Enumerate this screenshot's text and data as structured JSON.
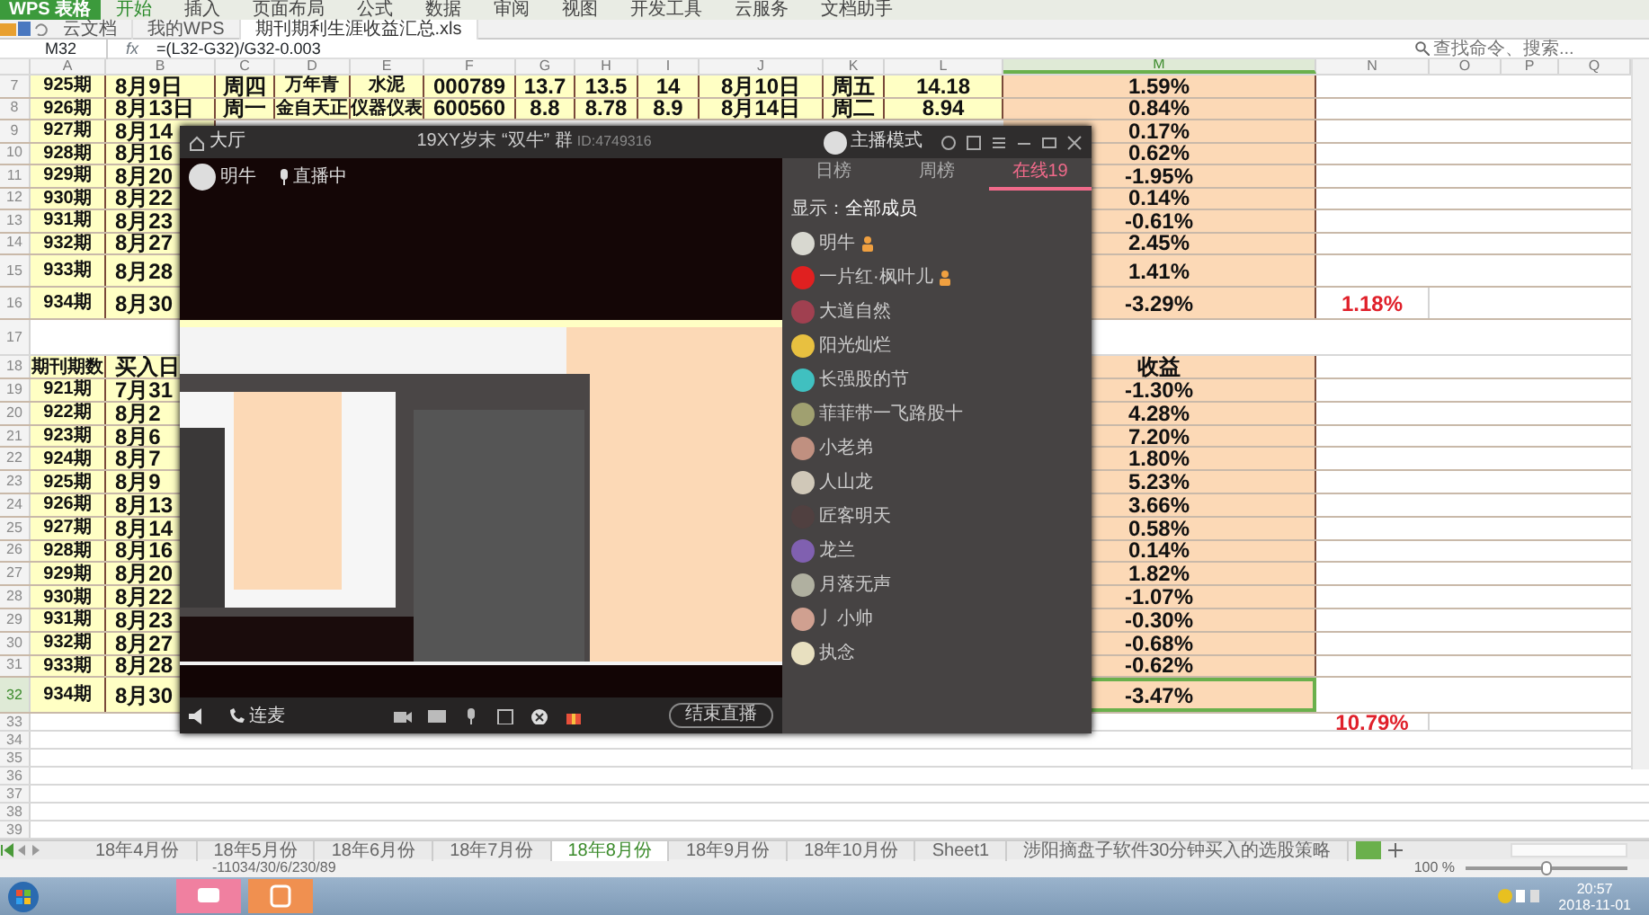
{
  "app": {
    "title": "WPS 表格",
    "menu": [
      {
        "label": "开始",
        "selected": true
      },
      {
        "label": "插入",
        "selected": false
      },
      {
        "label": "页面布局",
        "selected": false
      },
      {
        "label": "公式",
        "selected": false
      },
      {
        "label": "数据",
        "selected": false
      },
      {
        "label": "审阅",
        "selected": false
      },
      {
        "label": "视图",
        "selected": false
      },
      {
        "label": "开发工具",
        "selected": false
      },
      {
        "label": "云服务",
        "selected": false
      },
      {
        "label": "文档助手",
        "selected": false
      }
    ],
    "doc_tabs": [
      {
        "label": "云文档",
        "selected": false
      },
      {
        "label": "我的WPS",
        "selected": false
      },
      {
        "label": "期刊期利生涯收益汇总.xls",
        "selected": true
      }
    ],
    "search": {
      "placeholder": "查找命令、搜索..."
    }
  },
  "formula_bar": {
    "cell": "M32",
    "fx": "fx",
    "formula": "=(L32-G32)/G32-0.003"
  },
  "sheet": {
    "columns": [
      {
        "letter": "A",
        "selected": false
      },
      {
        "letter": "B",
        "selected": false
      },
      {
        "letter": "C",
        "selected": false
      },
      {
        "letter": "D",
        "selected": false
      },
      {
        "letter": "E",
        "selected": false
      },
      {
        "letter": "F",
        "selected": false
      },
      {
        "letter": "G",
        "selected": false
      },
      {
        "letter": "H",
        "selected": false
      },
      {
        "letter": "I",
        "selected": false
      },
      {
        "letter": "J",
        "selected": false
      },
      {
        "letter": "K",
        "selected": false
      },
      {
        "letter": "L",
        "selected": false
      },
      {
        "letter": "M",
        "selected": true
      },
      {
        "letter": "N",
        "selected": false
      },
      {
        "letter": "O",
        "selected": false
      },
      {
        "letter": "P",
        "selected": false
      },
      {
        "letter": "Q",
        "selected": false
      }
    ],
    "rows": [
      {
        "number": "7",
        "kind": "record",
        "selected": false,
        "cells": {
          "A": "925期",
          "B": "8月9日",
          "C": "周四",
          "D": "万年青",
          "E": "水泥",
          "F": "000789",
          "G": "13.7",
          "H": "13.5",
          "I": "14",
          "J": "8月10日",
          "K": "周五",
          "L": "14.18",
          "M": "1.59%"
        }
      },
      {
        "number": "8",
        "kind": "record",
        "selected": false,
        "cells": {
          "A": "926期",
          "B": "8月13日",
          "C": "周一",
          "D": "金自天正",
          "E": "仪器仪表",
          "F": "600560",
          "G": "8.8",
          "H": "8.78",
          "I": "8.9",
          "J": "8月14日",
          "K": "周二",
          "L": "8.94",
          "M": "0.84%"
        }
      },
      {
        "number": "9",
        "kind": "record",
        "selected": false,
        "cells": {
          "A": "927期",
          "B": "8月14",
          "M": "0.17%"
        }
      },
      {
        "number": "10",
        "kind": "record",
        "selected": false,
        "cells": {
          "A": "928期",
          "B": "8月16",
          "M": "0.62%"
        }
      },
      {
        "number": "11",
        "kind": "record",
        "selected": false,
        "cells": {
          "A": "929期",
          "B": "8月20",
          "M": "-1.95%"
        }
      },
      {
        "number": "12",
        "kind": "record",
        "selected": false,
        "cells": {
          "A": "930期",
          "B": "8月22",
          "M": "0.14%"
        }
      },
      {
        "number": "13",
        "kind": "record",
        "selected": false,
        "cells": {
          "A": "931期",
          "B": "8月23",
          "M": "-0.61%"
        }
      },
      {
        "number": "14",
        "kind": "record",
        "selected": false,
        "cells": {
          "A": "932期",
          "B": "8月27",
          "M": "2.45%"
        }
      },
      {
        "number": "15",
        "kind": "record",
        "selected": false,
        "cells": {
          "A": "933期",
          "B": "8月28",
          "M": "1.41%"
        }
      },
      {
        "number": "16",
        "kind": "record",
        "selected": false,
        "cells": {
          "A": "934期",
          "B": "8月30",
          "M": "-3.29%",
          "N": "1.18%"
        }
      },
      {
        "number": "17",
        "kind": "blank",
        "selected": false,
        "cells": {}
      },
      {
        "number": "18",
        "kind": "record",
        "selected": false,
        "cells": {
          "A": "期刊期数",
          "B": "买入日",
          "M": "收益"
        }
      },
      {
        "number": "19",
        "kind": "record",
        "selected": false,
        "cells": {
          "A": "921期",
          "B": "7月31",
          "M": "-1.30%"
        }
      },
      {
        "number": "20",
        "kind": "record",
        "selected": false,
        "cells": {
          "A": "922期",
          "B": "8月2",
          "M": "4.28%"
        }
      },
      {
        "number": "21",
        "kind": "record",
        "selected": false,
        "cells": {
          "A": "923期",
          "B": "8月6",
          "M": "7.20%"
        }
      },
      {
        "number": "22",
        "kind": "record",
        "selected": false,
        "cells": {
          "A": "924期",
          "B": "8月7",
          "M": "1.80%"
        }
      },
      {
        "number": "23",
        "kind": "record",
        "selected": false,
        "cells": {
          "A": "925期",
          "B": "8月9",
          "M": "5.23%"
        }
      },
      {
        "number": "24",
        "kind": "record",
        "selected": false,
        "cells": {
          "A": "926期",
          "B": "8月13",
          "M": "3.66%"
        }
      },
      {
        "number": "25",
        "kind": "record",
        "selected": false,
        "cells": {
          "A": "927期",
          "B": "8月14",
          "M": "0.58%"
        }
      },
      {
        "number": "26",
        "kind": "record",
        "selected": false,
        "cells": {
          "A": "928期",
          "B": "8月16",
          "M": "0.14%"
        }
      },
      {
        "number": "27",
        "kind": "record",
        "selected": false,
        "cells": {
          "A": "929期",
          "B": "8月20",
          "M": "1.82%"
        }
      },
      {
        "number": "28",
        "kind": "record",
        "selected": false,
        "cells": {
          "A": "930期",
          "B": "8月22",
          "M": "-1.07%"
        }
      },
      {
        "number": "29",
        "kind": "record",
        "selected": false,
        "cells": {
          "A": "931期",
          "B": "8月23",
          "M": "-0.30%"
        }
      },
      {
        "number": "30",
        "kind": "record",
        "selected": false,
        "cells": {
          "A": "932期",
          "B": "8月27",
          "M": "-0.68%"
        }
      },
      {
        "number": "31",
        "kind": "record",
        "selected": false,
        "cells": {
          "A": "933期",
          "B": "8月28",
          "M": "-0.62%"
        }
      },
      {
        "number": "32",
        "kind": "record",
        "selected": true,
        "cells": {
          "A": "934期",
          "B": "8月30",
          "M": "-3.47%"
        }
      },
      {
        "number": "33",
        "kind": "blank",
        "selected": false,
        "cells": {
          "N": "10.79%"
        }
      },
      {
        "number": "34",
        "kind": "blank",
        "selected": false,
        "cells": {}
      },
      {
        "number": "35",
        "kind": "blank",
        "selected": false,
        "cells": {}
      },
      {
        "number": "36",
        "kind": "blank",
        "selected": false,
        "cells": {}
      },
      {
        "number": "37",
        "kind": "blank",
        "selected": false,
        "cells": {}
      },
      {
        "number": "38",
        "kind": "blank",
        "selected": false,
        "cells": {}
      },
      {
        "number": "39",
        "kind": "blank",
        "selected": false,
        "cells": {}
      }
    ]
  },
  "chat_window": {
    "home_label": "大厅",
    "title": "19XY岁末 “双牛” 群",
    "room_id": "ID:4749316",
    "mode_label": "主播模式",
    "host_name": "明牛",
    "host_status": "直播中",
    "tabs": [
      {
        "label": "日榜",
        "selected": false
      },
      {
        "label": "周榜",
        "selected": false
      },
      {
        "label": "在线19",
        "selected": true
      }
    ],
    "filter_label": "显示：",
    "filter_value": "全部成员",
    "members": [
      {
        "name": "明牛",
        "admin": true,
        "color": "#d8d8d0"
      },
      {
        "name": "一片红·枫叶儿",
        "admin": true,
        "color": "#e02020"
      },
      {
        "name": "大道自然",
        "admin": false,
        "color": "#a04050"
      },
      {
        "name": "阳光灿烂",
        "admin": false,
        "color": "#e8c040"
      },
      {
        "name": "长强股的节",
        "admin": false,
        "color": "#40c0c0"
      },
      {
        "name": "菲菲带一飞路股十",
        "admin": false,
        "color": "#a0a070"
      },
      {
        "name": "小老弟",
        "admin": false,
        "color": "#c09080"
      },
      {
        "name": "人山龙",
        "admin": false,
        "color": "#d0c8b8"
      },
      {
        "name": "匠客明天",
        "admin": false,
        "color": "#504040"
      },
      {
        "name": "龙兰",
        "admin": false,
        "color": "#8060b0"
      },
      {
        "name": "月落无声",
        "admin": false,
        "color": "#b0b0a0"
      },
      {
        "name": "丿小帅",
        "admin": false,
        "color": "#d0a090"
      },
      {
        "name": "执念",
        "admin": false,
        "color": "#e8e0c0"
      }
    ],
    "call_label": "连麦",
    "end_button": "结束直播"
  },
  "sheet_tabs": [
    {
      "label": "18年4月份",
      "selected": false
    },
    {
      "label": "18年5月份",
      "selected": false
    },
    {
      "label": "18年6月份",
      "selected": false
    },
    {
      "label": "18年7月份",
      "selected": false
    },
    {
      "label": "18年8月份",
      "selected": true
    },
    {
      "label": "18年9月份",
      "selected": false
    },
    {
      "label": "18年10月份",
      "selected": false
    },
    {
      "label": "Sheet1",
      "selected": false
    },
    {
      "label": "涉阳摘盘子软件30分钟买入的选股策略",
      "selected": false
    }
  ],
  "status_bar": {
    "summary": "-11034/30/6/230/89",
    "zoom": "100 %",
    "zoom_slider": {
      "level": 0.5
    }
  },
  "taskbar": {
    "time": "20:57",
    "date": "2018-11-01"
  }
}
